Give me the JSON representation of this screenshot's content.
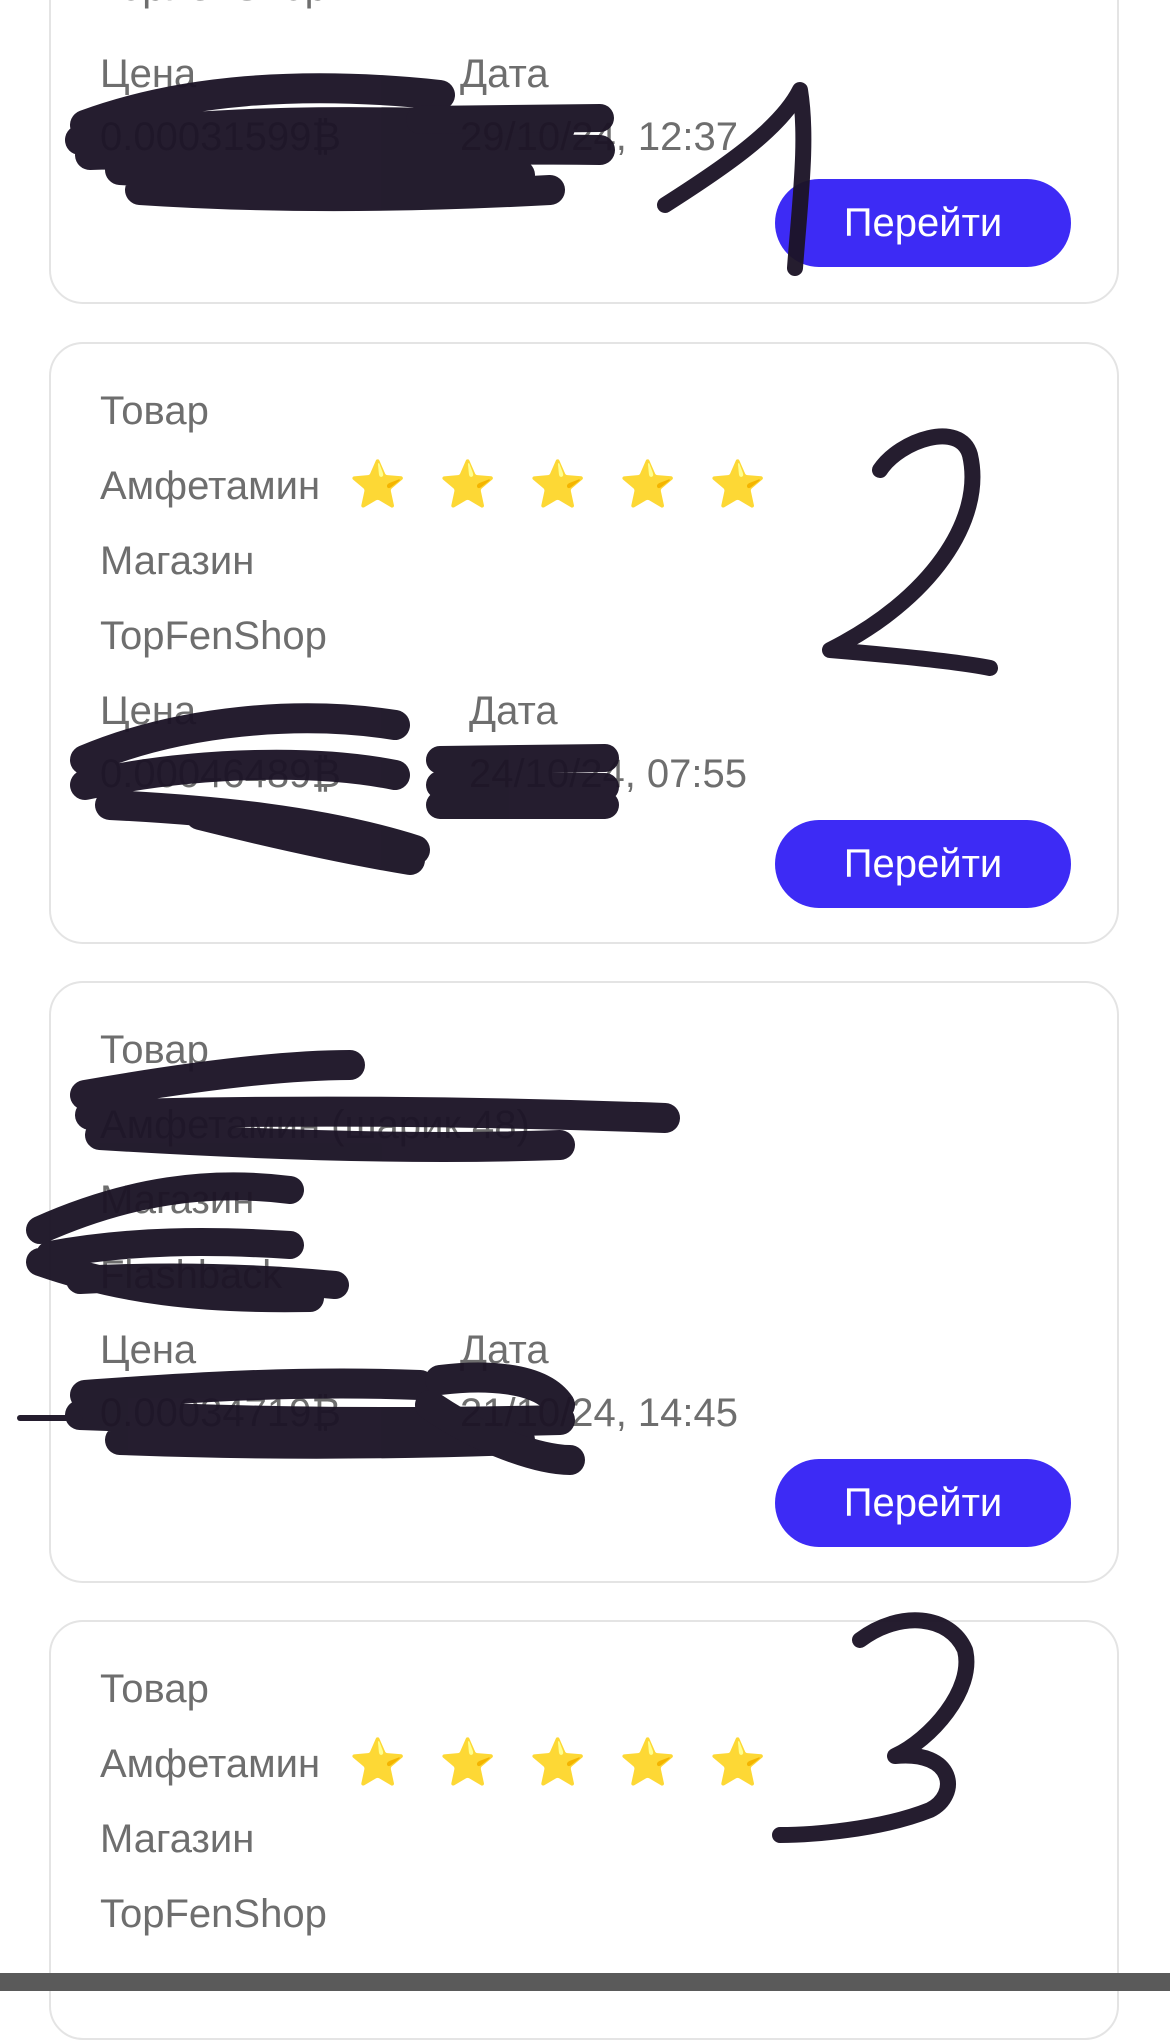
{
  "orders": [
    {
      "shop_value": "TopFenShop",
      "price_label": "Цена",
      "price_value": "0.00031599₿",
      "date_label": "Дата",
      "date_value": "29/10/24, 12:37",
      "button_label": "Перейти",
      "handwritten_number": "1"
    },
    {
      "product_label": "Товар",
      "product_value": "Амфетамин",
      "rating_stars": "⭐ ⭐ ⭐ ⭐ ⭐",
      "shop_label": "Магазин",
      "shop_value": "TopFenShop",
      "price_label": "Цена",
      "price_value": "0.00046489₿",
      "date_label": "Дата",
      "date_value": "24/10/24, 07:55",
      "button_label": "Перейти",
      "handwritten_number": "2"
    },
    {
      "product_label": "Товар",
      "product_value": "Амфетамин (шарик 48)",
      "shop_label": "Магазин",
      "shop_value": "Flashback",
      "price_label": "Цена",
      "price_value": "0.00034719₿",
      "date_label": "Дата",
      "date_value": "21/10/24, 14:45",
      "button_label": "Перейти"
    },
    {
      "product_label": "Товар",
      "product_value": "Амфетамин",
      "rating_stars": "⭐ ⭐ ⭐ ⭐ ⭐",
      "shop_label": "Магазин",
      "shop_value": "TopFenShop",
      "handwritten_number": "3"
    }
  ],
  "colors": {
    "button_bg": "#3d2bf5",
    "button_text": "#ffffff",
    "card_border": "#e4e4e4",
    "text": "#6e6e6e",
    "scribble": "#1c1426"
  }
}
